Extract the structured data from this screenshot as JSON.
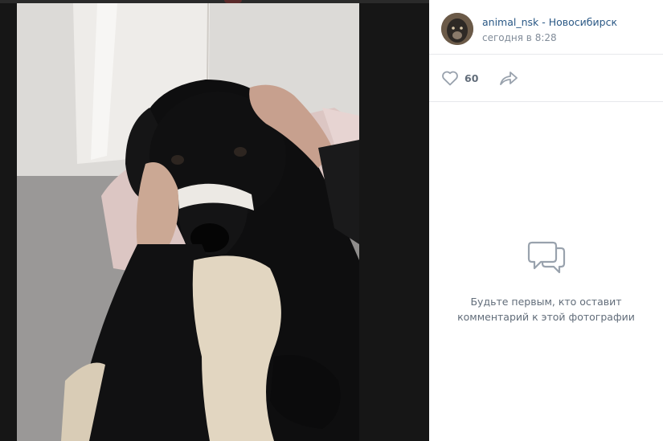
{
  "post": {
    "author_name": "animal_nsk - Новосибирск",
    "time": "сегодня в 8:28"
  },
  "actions": {
    "like_icon": "heart-icon",
    "like_count": "60",
    "share_icon": "share-arrow-icon"
  },
  "comments": {
    "empty_icon": "comments-bubbles-icon",
    "empty_line1": "Будьте первым, кто оставит",
    "empty_line2": "комментарий к этой фотографии"
  },
  "colors": {
    "link": "#2a5885",
    "muted": "#818c99",
    "text": "#626d7a",
    "icon": "#99a2ad",
    "background_dark": "#161616"
  }
}
